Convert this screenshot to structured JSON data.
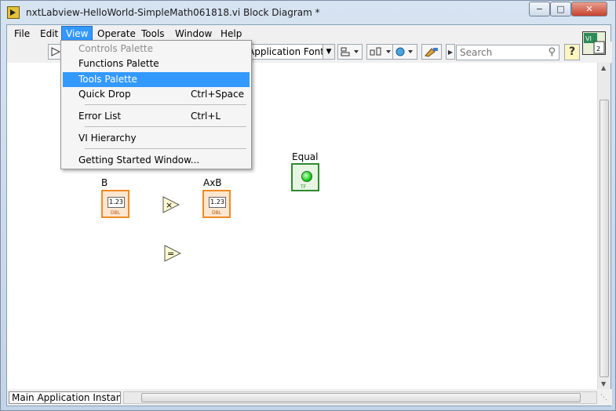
{
  "window": {
    "title": "nxtLabview-HelloWorld-SimpleMath061818.vi Block Diagram *",
    "min_label": "−",
    "max_label": "□",
    "close_label": "✕"
  },
  "menubar": {
    "items": [
      "File",
      "Edit",
      "View",
      "Operate",
      "Tools",
      "Window",
      "Help"
    ],
    "active": "View"
  },
  "toolbar": {
    "font_label": "Application Font",
    "search_placeholder": "Search",
    "help_label": "?",
    "vi_icon_text": "VI\n▦"
  },
  "view_menu": {
    "items": [
      {
        "label": "Controls Palette",
        "shortcut": "",
        "state": "disabled"
      },
      {
        "label": "Functions Palette",
        "shortcut": "",
        "state": "normal"
      },
      {
        "label": "Tools Palette",
        "shortcut": "",
        "state": "highlighted"
      },
      {
        "label": "Quick Drop",
        "shortcut": "Ctrl+Space",
        "state": "normal"
      },
      {
        "label": "Error List",
        "shortcut": "Ctrl+L",
        "state": "normal"
      },
      {
        "label": "VI Hierarchy",
        "shortcut": "",
        "state": "normal"
      },
      {
        "label": "Getting Started Window...",
        "shortcut": "",
        "state": "normal"
      }
    ]
  },
  "diagram": {
    "b_label": "B",
    "axb_label": "AxB",
    "equal_label": "Equal",
    "num_display": "1.23",
    "dbl_tag": "DBL",
    "tf_tag": "TF",
    "multiply_symbol": "×",
    "equal_symbol": "="
  },
  "status": {
    "instance": "Main Application Instance"
  },
  "colors": {
    "numeric_terminal": "#f08a24",
    "boolean_terminal": "#2e8b2e",
    "highlight": "#3399ff"
  }
}
